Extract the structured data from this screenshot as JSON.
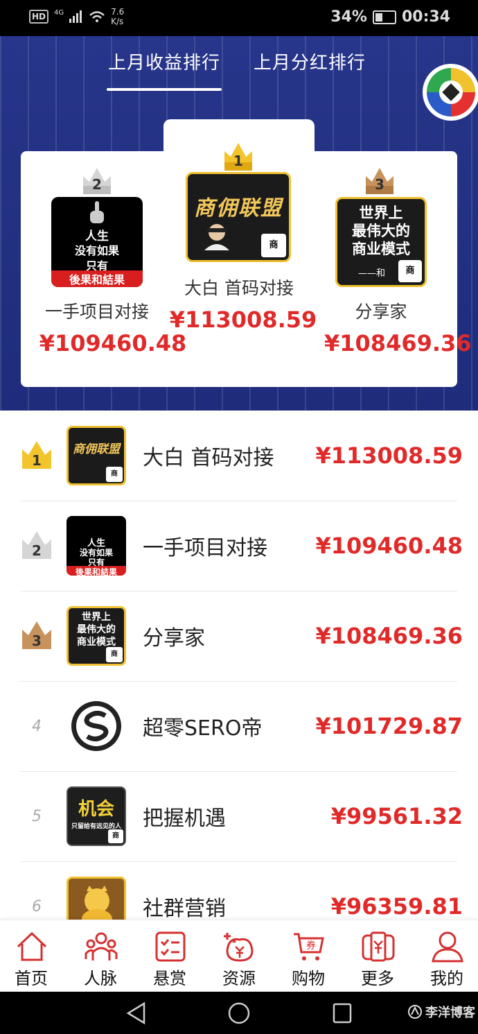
{
  "status": {
    "hd": "HD",
    "net": "4G",
    "speed": "7.6",
    "speed_unit": "K/s",
    "battery": "34%",
    "time": "00:34"
  },
  "tabs": [
    {
      "label": "上月收益排行"
    },
    {
      "label": "上月分红排行"
    }
  ],
  "podium": [
    {
      "rank": "2",
      "name": "一手项目对接",
      "amount": "¥109460.48"
    },
    {
      "rank": "1",
      "name": "大白 首码对接",
      "amount": "¥113008.59"
    },
    {
      "rank": "3",
      "name": "分享家",
      "amount": "¥108469.36"
    }
  ],
  "avatars": {
    "life": [
      "人生",
      "没有如果",
      "只有",
      "後果和結果"
    ],
    "alliance": [
      "商佣联盟",
      "商",
      "盟"
    ],
    "world": [
      "世界上",
      "最伟大的",
      "商业模式",
      "——和"
    ],
    "chance": [
      "机会",
      "只留给有远见的人"
    ]
  },
  "list": [
    {
      "rank": "1",
      "name": "大白 首码对接",
      "amount": "¥113008.59"
    },
    {
      "rank": "2",
      "name": "一手项目对接",
      "amount": "¥109460.48"
    },
    {
      "rank": "3",
      "name": "分享家",
      "amount": "¥108469.36"
    },
    {
      "rank": "4",
      "name": "超零SERO帝",
      "amount": "¥101729.87"
    },
    {
      "rank": "5",
      "name": "把握机遇",
      "amount": "¥99561.32"
    },
    {
      "rank": "6",
      "name": "社群营销",
      "amount": "¥96359.81"
    }
  ],
  "bottom_nav": [
    {
      "label": "首页",
      "icon": "home-icon"
    },
    {
      "label": "人脉",
      "icon": "contacts-icon"
    },
    {
      "label": "悬赏",
      "icon": "reward-icon"
    },
    {
      "label": "资源",
      "icon": "resource-icon"
    },
    {
      "label": "购物",
      "icon": "cart-icon"
    },
    {
      "label": "更多",
      "icon": "more-icon"
    },
    {
      "label": "我的",
      "icon": "user-icon"
    }
  ],
  "watermark": "李洋博客",
  "colors": {
    "accent": "#e02a2a",
    "header": "#27358a",
    "gold": "#f0c030",
    "silver": "#cfcfcf",
    "bronze": "#c08a55"
  }
}
